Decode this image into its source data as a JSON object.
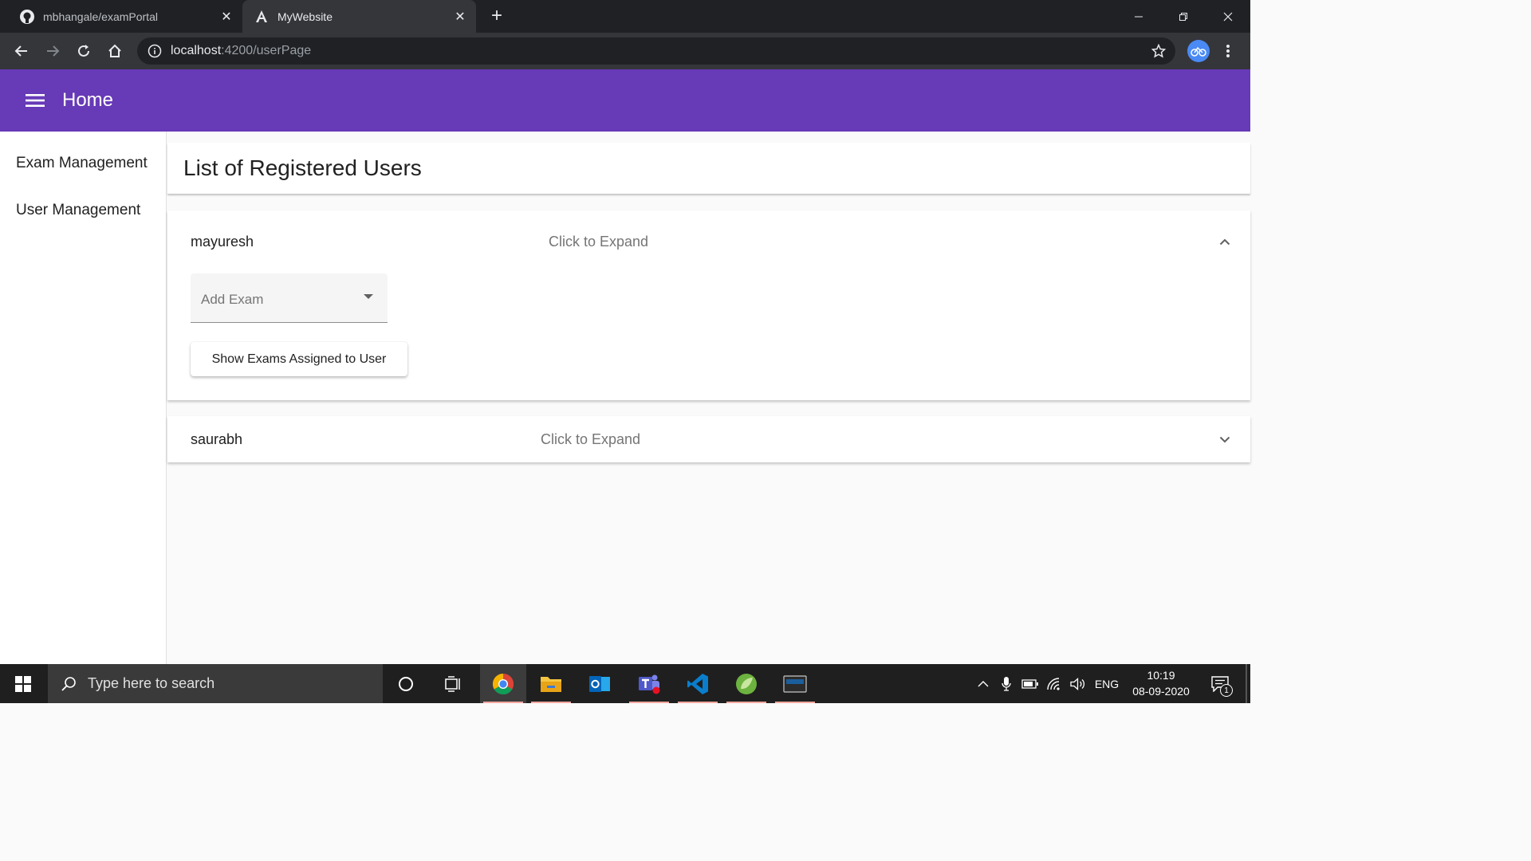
{
  "browser": {
    "tabs": [
      {
        "title": "mbhangale/examPortal",
        "icon": "github-icon",
        "active": false
      },
      {
        "title": "MyWebsite",
        "icon": "angular-icon",
        "active": true
      }
    ],
    "url_host": "localhost",
    "url_path": ":4200/userPage"
  },
  "app": {
    "title": "Home",
    "accent_color": "#673ab7"
  },
  "sidebar": {
    "items": [
      {
        "label": "Exam Management"
      },
      {
        "label": "User Management"
      }
    ]
  },
  "main": {
    "page_title": "List of Registered Users",
    "users": [
      {
        "name": "mayuresh",
        "hint": "Click to Expand",
        "expanded": true,
        "select_placeholder": "Add Exam",
        "button_label": "Show Exams Assigned to User"
      },
      {
        "name": "saurabh",
        "hint": "Click to Expand",
        "expanded": false
      }
    ]
  },
  "taskbar": {
    "search_placeholder": "Type here to search",
    "language": "ENG",
    "time": "10:19",
    "date": "08-09-2020",
    "notification_count": "1"
  }
}
